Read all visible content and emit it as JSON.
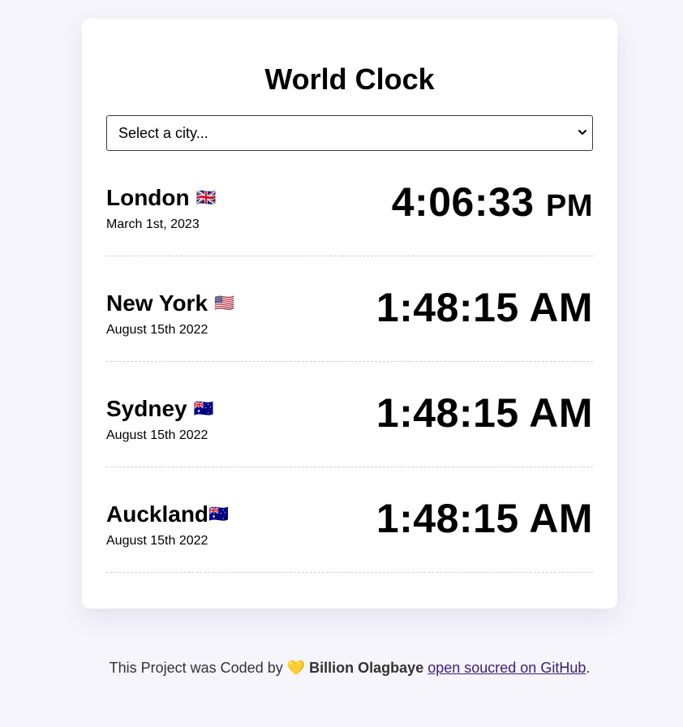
{
  "app": {
    "title": "World Clock"
  },
  "select": {
    "value": "Select a city..."
  },
  "cities": [
    {
      "name": "London",
      "flag": "🇬🇧",
      "date": "March 1st, 2023",
      "time": "4:06:33",
      "ampm": "PM"
    },
    {
      "name": "New York",
      "flag": "🇺🇸",
      "date": "August 15th 2022",
      "time": "1:48:15",
      "ampm": "AM"
    },
    {
      "name": "Sydney",
      "flag": "🇦🇺",
      "date": "August 15th 2022",
      "time": "1:48:15",
      "ampm": "AM"
    },
    {
      "name": "Auckland",
      "flag": "🇦🇺",
      "date": "August 15th 2022",
      "time": "1:48:15",
      "ampm": "AM"
    }
  ],
  "footer": {
    "prefix": "This Project was Coded by",
    "heart": "💛",
    "author": "Billion Olagbaye",
    "link_text": "open soucred on GitHub",
    "suffix": "."
  },
  "colors": {
    "background": "#f6f5fb",
    "card": "#ffffff",
    "link": "#3b1e7a"
  }
}
